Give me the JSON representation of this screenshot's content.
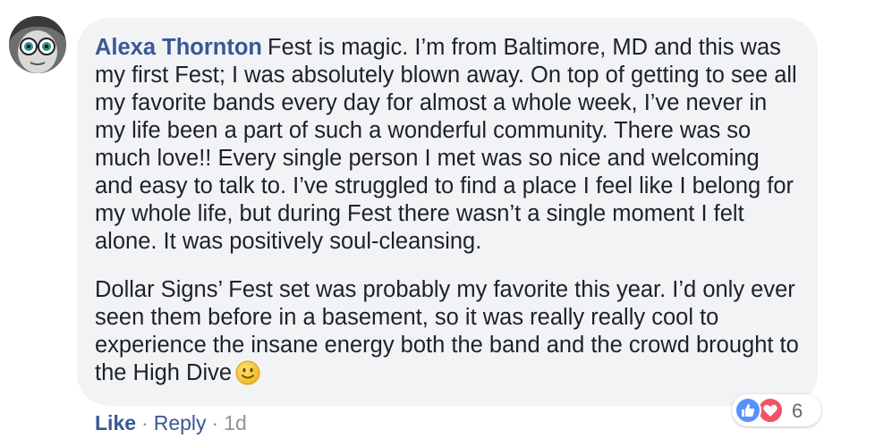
{
  "comment": {
    "author": "Alexa Thornton",
    "paragraph1": "Fest is magic. I’m from Baltimore, MD and this was my first Fest; I was absolutely blown away. On top of getting to see all my favorite bands every day for almost a whole week, I’ve never in my life been a part of such a wonderful community. There was so much love!! Every single person I met was so nice and welcoming and easy to talk to. I’ve struggled to find a place I feel like I belong for my whole life, but during Fest there wasn’t a single moment I felt alone. It was positively soul-cleansing.",
    "paragraph2": "Dollar Signs’ Fest set was probably my favorite this year. I’d only ever seen them before in a basement, so it was really really cool to experience the insane energy both the band and the crowd brought to the High Dive",
    "emoji": "slightly-smiling-face-icon"
  },
  "reactions": {
    "types": [
      "like-icon",
      "love-icon"
    ],
    "count": "6",
    "colors": {
      "like": "#5890ff",
      "love": "#f25268"
    }
  },
  "actions": {
    "like_label": "Like",
    "separator": "·",
    "reply_label": "Reply",
    "timestamp": "1d"
  },
  "colors": {
    "link": "#385898",
    "bubble": "#f2f3f5",
    "meta": "#90949c"
  }
}
